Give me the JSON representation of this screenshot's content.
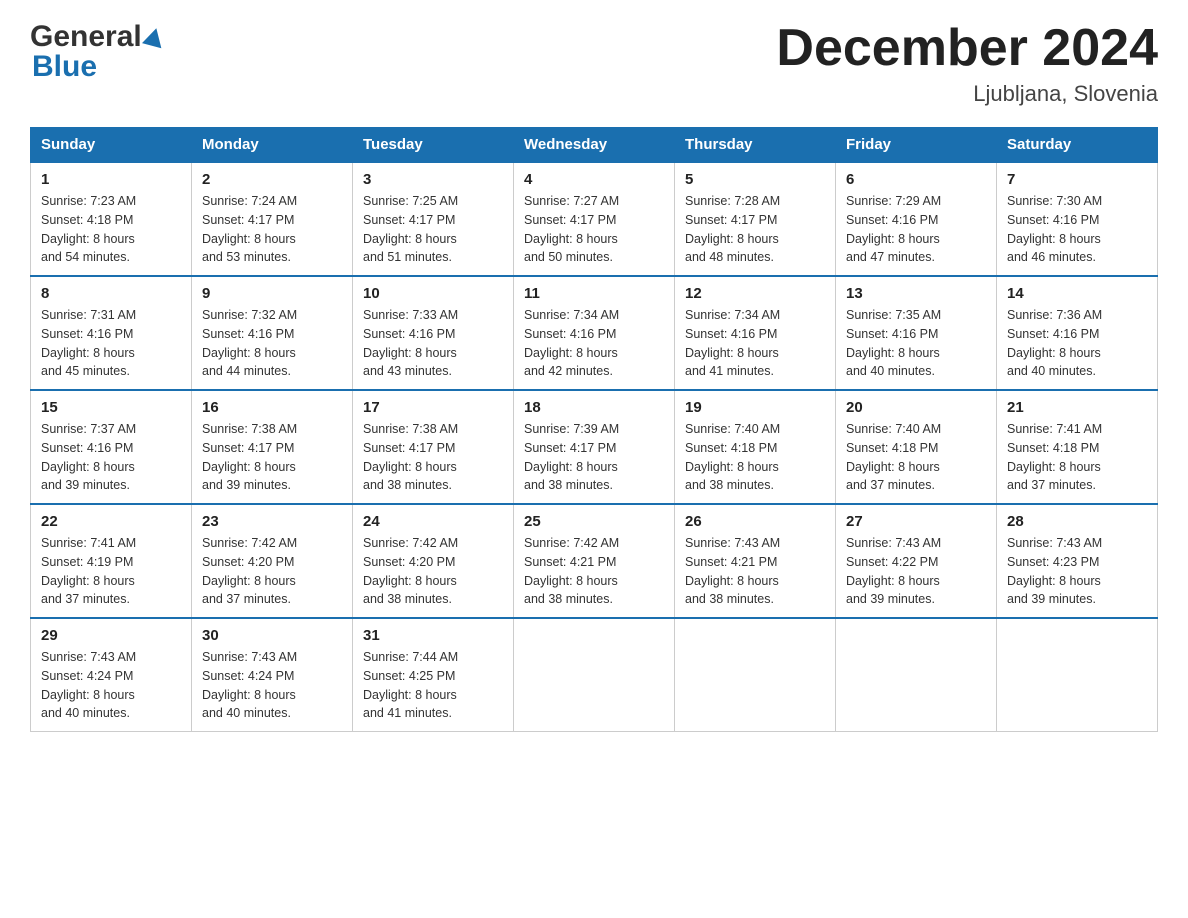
{
  "header": {
    "title": "December 2024",
    "location": "Ljubljana, Slovenia",
    "logo_general": "General",
    "logo_blue": "Blue"
  },
  "weekdays": [
    "Sunday",
    "Monday",
    "Tuesday",
    "Wednesday",
    "Thursday",
    "Friday",
    "Saturday"
  ],
  "weeks": [
    [
      {
        "day": "1",
        "sunrise": "7:23 AM",
        "sunset": "4:18 PM",
        "daylight": "8 hours and 54 minutes."
      },
      {
        "day": "2",
        "sunrise": "7:24 AM",
        "sunset": "4:17 PM",
        "daylight": "8 hours and 53 minutes."
      },
      {
        "day": "3",
        "sunrise": "7:25 AM",
        "sunset": "4:17 PM",
        "daylight": "8 hours and 51 minutes."
      },
      {
        "day": "4",
        "sunrise": "7:27 AM",
        "sunset": "4:17 PM",
        "daylight": "8 hours and 50 minutes."
      },
      {
        "day": "5",
        "sunrise": "7:28 AM",
        "sunset": "4:17 PM",
        "daylight": "8 hours and 48 minutes."
      },
      {
        "day": "6",
        "sunrise": "7:29 AM",
        "sunset": "4:16 PM",
        "daylight": "8 hours and 47 minutes."
      },
      {
        "day": "7",
        "sunrise": "7:30 AM",
        "sunset": "4:16 PM",
        "daylight": "8 hours and 46 minutes."
      }
    ],
    [
      {
        "day": "8",
        "sunrise": "7:31 AM",
        "sunset": "4:16 PM",
        "daylight": "8 hours and 45 minutes."
      },
      {
        "day": "9",
        "sunrise": "7:32 AM",
        "sunset": "4:16 PM",
        "daylight": "8 hours and 44 minutes."
      },
      {
        "day": "10",
        "sunrise": "7:33 AM",
        "sunset": "4:16 PM",
        "daylight": "8 hours and 43 minutes."
      },
      {
        "day": "11",
        "sunrise": "7:34 AM",
        "sunset": "4:16 PM",
        "daylight": "8 hours and 42 minutes."
      },
      {
        "day": "12",
        "sunrise": "7:34 AM",
        "sunset": "4:16 PM",
        "daylight": "8 hours and 41 minutes."
      },
      {
        "day": "13",
        "sunrise": "7:35 AM",
        "sunset": "4:16 PM",
        "daylight": "8 hours and 40 minutes."
      },
      {
        "day": "14",
        "sunrise": "7:36 AM",
        "sunset": "4:16 PM",
        "daylight": "8 hours and 40 minutes."
      }
    ],
    [
      {
        "day": "15",
        "sunrise": "7:37 AM",
        "sunset": "4:16 PM",
        "daylight": "8 hours and 39 minutes."
      },
      {
        "day": "16",
        "sunrise": "7:38 AM",
        "sunset": "4:17 PM",
        "daylight": "8 hours and 39 minutes."
      },
      {
        "day": "17",
        "sunrise": "7:38 AM",
        "sunset": "4:17 PM",
        "daylight": "8 hours and 38 minutes."
      },
      {
        "day": "18",
        "sunrise": "7:39 AM",
        "sunset": "4:17 PM",
        "daylight": "8 hours and 38 minutes."
      },
      {
        "day": "19",
        "sunrise": "7:40 AM",
        "sunset": "4:18 PM",
        "daylight": "8 hours and 38 minutes."
      },
      {
        "day": "20",
        "sunrise": "7:40 AM",
        "sunset": "4:18 PM",
        "daylight": "8 hours and 37 minutes."
      },
      {
        "day": "21",
        "sunrise": "7:41 AM",
        "sunset": "4:18 PM",
        "daylight": "8 hours and 37 minutes."
      }
    ],
    [
      {
        "day": "22",
        "sunrise": "7:41 AM",
        "sunset": "4:19 PM",
        "daylight": "8 hours and 37 minutes."
      },
      {
        "day": "23",
        "sunrise": "7:42 AM",
        "sunset": "4:20 PM",
        "daylight": "8 hours and 37 minutes."
      },
      {
        "day": "24",
        "sunrise": "7:42 AM",
        "sunset": "4:20 PM",
        "daylight": "8 hours and 38 minutes."
      },
      {
        "day": "25",
        "sunrise": "7:42 AM",
        "sunset": "4:21 PM",
        "daylight": "8 hours and 38 minutes."
      },
      {
        "day": "26",
        "sunrise": "7:43 AM",
        "sunset": "4:21 PM",
        "daylight": "8 hours and 38 minutes."
      },
      {
        "day": "27",
        "sunrise": "7:43 AM",
        "sunset": "4:22 PM",
        "daylight": "8 hours and 39 minutes."
      },
      {
        "day": "28",
        "sunrise": "7:43 AM",
        "sunset": "4:23 PM",
        "daylight": "8 hours and 39 minutes."
      }
    ],
    [
      {
        "day": "29",
        "sunrise": "7:43 AM",
        "sunset": "4:24 PM",
        "daylight": "8 hours and 40 minutes."
      },
      {
        "day": "30",
        "sunrise": "7:43 AM",
        "sunset": "4:24 PM",
        "daylight": "8 hours and 40 minutes."
      },
      {
        "day": "31",
        "sunrise": "7:44 AM",
        "sunset": "4:25 PM",
        "daylight": "8 hours and 41 minutes."
      },
      null,
      null,
      null,
      null
    ]
  ],
  "labels": {
    "sunrise": "Sunrise:",
    "sunset": "Sunset:",
    "daylight": "Daylight:"
  },
  "colors": {
    "header_bg": "#1a6faf",
    "header_border": "#1a6faf"
  }
}
